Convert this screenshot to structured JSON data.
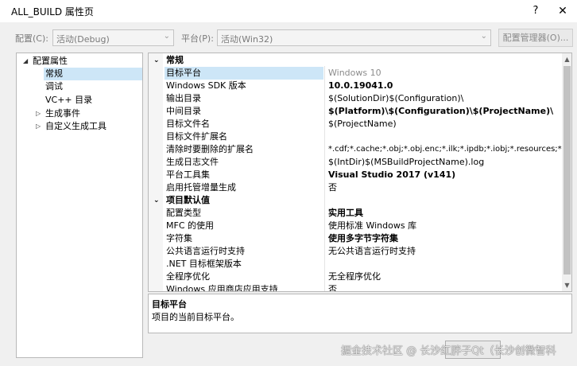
{
  "window": {
    "title": "ALL_BUILD 属性页",
    "help_glyph": "?",
    "close_glyph": "✕"
  },
  "toolbar": {
    "config_label": "配置(C):",
    "config_value": "活动(Debug)",
    "platform_label": "平台(P):",
    "platform_value": "活动(Win32)",
    "config_manager_label": "配置管理器(O)..."
  },
  "tree": {
    "items": [
      {
        "label": "配置属性",
        "toggle": "◢"
      },
      {
        "label": "常规"
      },
      {
        "label": "调试"
      },
      {
        "label": "VC++ 目录"
      },
      {
        "label": "生成事件",
        "toggle": "▷"
      },
      {
        "label": "自定义生成工具",
        "toggle": "▷"
      }
    ]
  },
  "grid": {
    "categories": [
      {
        "name": "常规",
        "toggle": "⌄"
      },
      {
        "name": "项目默认值",
        "toggle": "⌄"
      }
    ],
    "general_rows": [
      {
        "name": "目标平台",
        "value": "Windows 10"
      },
      {
        "name": "Windows SDK 版本",
        "value": "10.0.19041.0"
      },
      {
        "name": "输出目录",
        "value": "$(SolutionDir)$(Configuration)\\"
      },
      {
        "name": "中间目录",
        "value": "$(Platform)\\$(Configuration)\\$(ProjectName)\\"
      },
      {
        "name": "目标文件名",
        "value": "$(ProjectName)"
      },
      {
        "name": "目标文件扩展名",
        "value": ""
      },
      {
        "name": "清除时要删除的扩展名",
        "value": "*.cdf;*.cache;*.obj;*.obj.enc;*.ilk;*.ipdb;*.iobj;*.resources;*.tlb;*"
      },
      {
        "name": "生成日志文件",
        "value": "$(IntDir)$(MSBuildProjectName).log"
      },
      {
        "name": "平台工具集",
        "value": "Visual Studio 2017 (v141)"
      },
      {
        "name": "启用托管增量生成",
        "value": "否"
      }
    ],
    "defaults_rows": [
      {
        "name": "配置类型",
        "value": "实用工具"
      },
      {
        "name": "MFC 的使用",
        "value": "使用标准 Windows 库"
      },
      {
        "name": "字符集",
        "value": "使用多字节字符集"
      },
      {
        "name": "公共语言运行时支持",
        "value": "无公共语言运行时支持"
      },
      {
        "name": ".NET 目标框架版本",
        "value": ""
      },
      {
        "name": "全程序优化",
        "value": "无全程序优化"
      },
      {
        "name": "Windows 应用商店应用支持",
        "value": "否"
      }
    ],
    "scroll_up": "▲",
    "scroll_down": "▼"
  },
  "description": {
    "title": "目标平台",
    "text": "项目的当前目标平台。"
  },
  "watermark": "掘金技术社区 @ 长沙红胖子Qt（长沙创微智科"
}
